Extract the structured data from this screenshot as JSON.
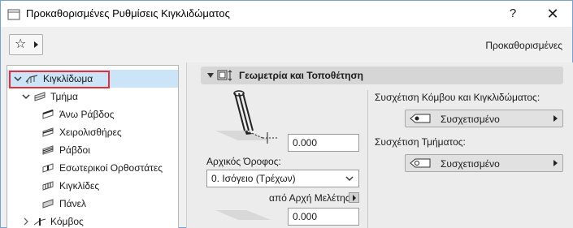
{
  "window": {
    "title": "Προκαθορισμένες Ρυθμίσεις Κιγκλιδώματος",
    "help_label": "?",
    "close_label": "✕"
  },
  "toolbar": {
    "favorites_icon": "star-icon",
    "preset_label": "Προκαθορισμένες"
  },
  "tree": {
    "items": [
      {
        "label": "Κιγκλίδωμα",
        "level": 0,
        "expanded": true,
        "selected": true,
        "icon": "railing-icon"
      },
      {
        "label": "Τμήμα",
        "level": 1,
        "expanded": true,
        "icon": "segment-icon"
      },
      {
        "label": "Άνω Ράβδος",
        "level": 2,
        "icon": "top-rail-icon"
      },
      {
        "label": "Χειρολισθήρες",
        "level": 2,
        "icon": "handrail-icon"
      },
      {
        "label": "Ράβδοι",
        "level": 2,
        "icon": "rails-icon"
      },
      {
        "label": "Εσωτερικοί Ορθοστάτες",
        "level": 2,
        "icon": "inner-post-icon"
      },
      {
        "label": "Κιγκλίδες",
        "level": 2,
        "icon": "balusters-icon"
      },
      {
        "label": "Πάνελ",
        "level": 2,
        "icon": "panel-icon"
      },
      {
        "label": "Κόμβος",
        "level": 1,
        "expanded": false,
        "icon": "node-icon"
      }
    ]
  },
  "section": {
    "title": "Γεωμετρία και Τοποθέτηση",
    "height_value": "0.000",
    "home_story_label": "Αρχικός Όροφος:",
    "home_story_value": "0. Ισόγειο (Τρέχων)",
    "offset_label": "από Αρχή Μελέτης",
    "offset_value": "0.000",
    "node_link_label": "Συσχέτιση Κόμβου και Κιγκλιδώματος:",
    "node_link_value": "Συσχετισμένο",
    "segment_link_label": "Συσχέτιση Τμήματος:",
    "segment_link_value": "Συσχετισμένο"
  },
  "colors": {
    "selection": "#cce4f7",
    "highlight_border": "#e0303a",
    "section_header": "#d6d6d6"
  }
}
